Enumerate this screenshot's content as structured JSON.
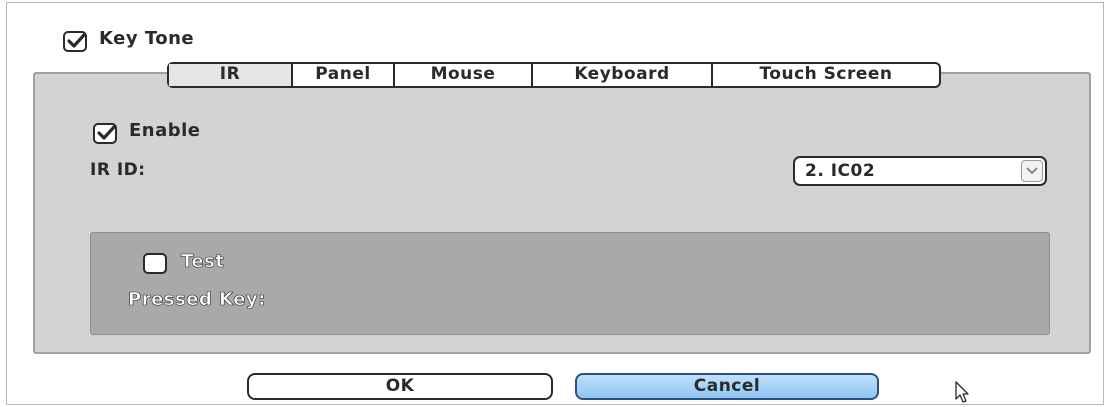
{
  "key_tone": {
    "label": "Key Tone",
    "checked": true
  },
  "tabs": [
    {
      "label": "IR",
      "active": true
    },
    {
      "label": "Panel",
      "active": false
    },
    {
      "label": "Mouse",
      "active": false
    },
    {
      "label": "Keyboard",
      "active": false
    },
    {
      "label": "Touch Screen",
      "active": false
    }
  ],
  "ir_panel": {
    "enable": {
      "label": "Enable",
      "checked": true
    },
    "ir_id": {
      "label": "IR ID:",
      "selected": "2. IC02"
    },
    "test": {
      "checkbox_label": "Test",
      "checked": false,
      "pressed_key_label": "Pressed Key:"
    }
  },
  "buttons": {
    "ok": "OK",
    "cancel": "Cancel"
  },
  "icons": {
    "check": "check-mark-icon",
    "dropdown": "chevron-down-icon",
    "cursor": "mouse-pointer-icon"
  },
  "colors": {
    "panel_bg": "#d3d3d3",
    "test_group_bg": "#a9a9a9",
    "cancel_button": "#a9d2f6"
  }
}
